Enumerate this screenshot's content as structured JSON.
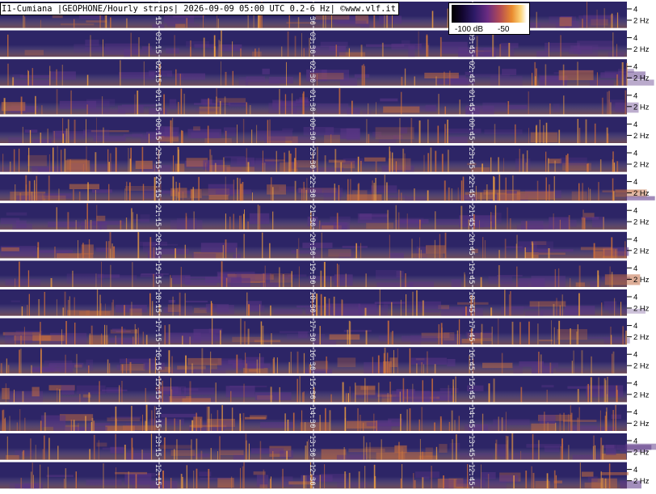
{
  "title": "I1-Cumiana |GEOPHONE/Hourly strips| 2026-09-09 05:00 UTC 0.2-6 Hz| ©www.vlf.it",
  "legend": {
    "low_label": "-100 dB",
    "high_label": "-50",
    "scale_colors": [
      "#000000",
      "#2c1a66",
      "#6a2c82",
      "#b24a55",
      "#e98a2e",
      "#fbd57a",
      "#ffffff"
    ]
  },
  "chart_data": {
    "type": "heatmap",
    "title": "I1-Cumiana |GEOPHONE/Hourly strips| 2026-09-09 05:00 UTC 0.2-6 Hz| ©www.vlf.it",
    "frequency_range_hz": [
      0.2,
      6
    ],
    "y_tick_labels": [
      "4",
      "2 Hz"
    ],
    "color_scale_db": [
      -100,
      -50
    ],
    "strip_duration_minutes": 60,
    "grid": "dashed vertical time markers every 15 minutes",
    "strips": [
      {
        "time_labels": [
          "04:15",
          "04:30",
          "04:45"
        ],
        "activity": "low"
      },
      {
        "time_labels": [
          "03:15",
          "03:30",
          "03:45"
        ],
        "activity": "low"
      },
      {
        "time_labels": [
          "02:15",
          "02:30",
          "02:45"
        ],
        "activity": "low"
      },
      {
        "time_labels": [
          "01:15",
          "01:30",
          "01:45"
        ],
        "activity": "low"
      },
      {
        "time_labels": [
          "00:15",
          "00:30",
          "00:45"
        ],
        "activity": "impulsive"
      },
      {
        "time_labels": [
          "23:15",
          "23:30",
          "23:45"
        ],
        "activity": "high"
      },
      {
        "time_labels": [
          "22:15",
          "22:30",
          "22:45"
        ],
        "activity": "high"
      },
      {
        "time_labels": [
          "21:15",
          "21:30",
          "21:45"
        ],
        "activity": "impulsive"
      },
      {
        "time_labels": [
          "20:15",
          "20:30",
          "20:45"
        ],
        "activity": "impulsive"
      },
      {
        "time_labels": [
          "19:15",
          "19:30",
          "19:45"
        ],
        "activity": "low"
      },
      {
        "time_labels": [
          "18:15",
          "18:30",
          "18:45"
        ],
        "activity": "moderate"
      },
      {
        "time_labels": [
          "17:15",
          "17:30",
          "17:45"
        ],
        "activity": "moderate"
      },
      {
        "time_labels": [
          "16:15",
          "16:30",
          "16:45"
        ],
        "activity": "moderate"
      },
      {
        "time_labels": [
          "15:15",
          "15:30",
          "15:45"
        ],
        "activity": "moderate"
      },
      {
        "time_labels": [
          "14:15",
          "14:30",
          "14:45"
        ],
        "activity": "high"
      },
      {
        "time_labels": [
          "13:15",
          "13:30",
          "13:45"
        ],
        "activity": "moderate"
      },
      {
        "time_labels": [
          "12:15",
          "12:30",
          "12:45"
        ],
        "activity": "moderate"
      }
    ]
  }
}
